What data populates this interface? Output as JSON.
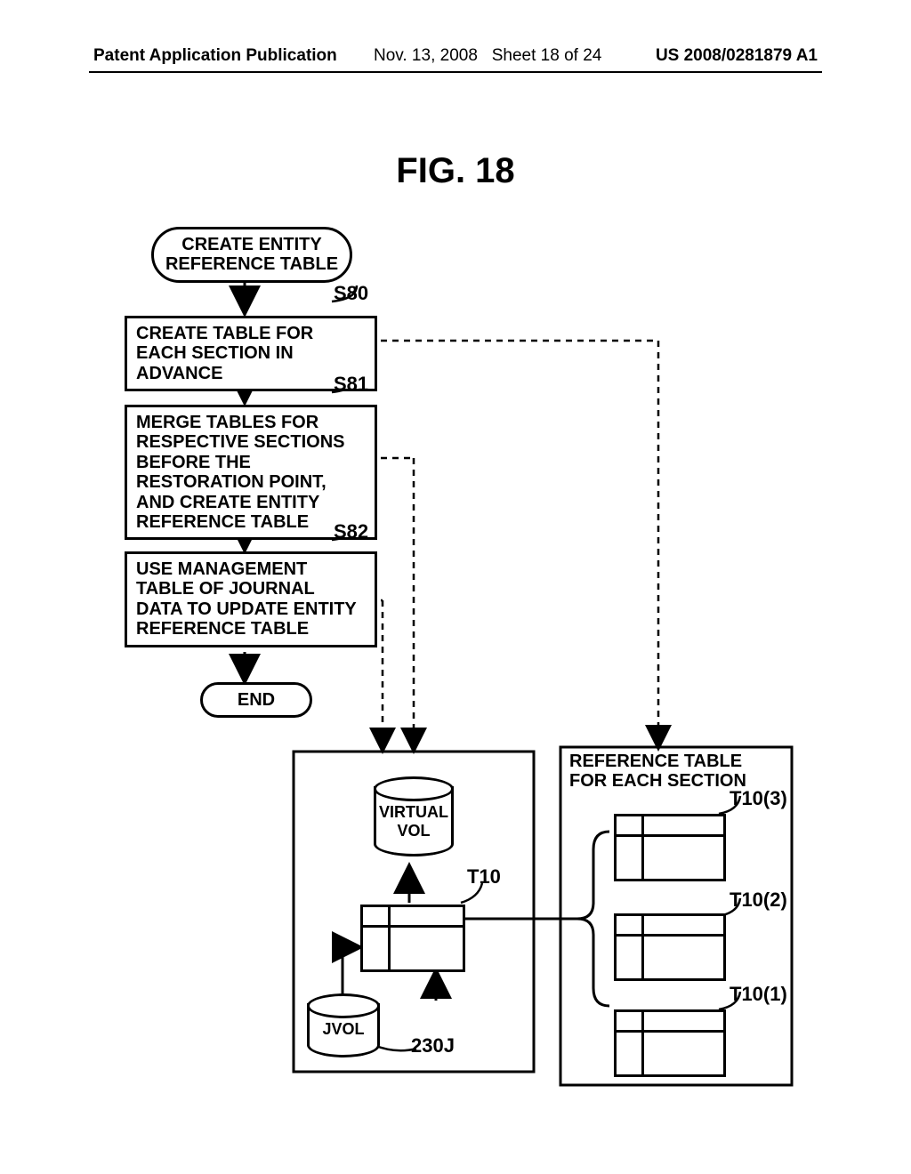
{
  "header": {
    "left": "Patent Application Publication",
    "date": "Nov. 13, 2008",
    "sheet": "Sheet 18 of 24",
    "pubno": "US 2008/0281879 A1"
  },
  "figure_title": "FIG. 18",
  "flowchart": {
    "start": "CREATE ENTITY REFERENCE TABLE",
    "s80": "CREATE TABLE FOR EACH SECTION IN ADVANCE",
    "s80_label": "S80",
    "s81": "MERGE TABLES FOR RESPECTIVE SECTIONS BEFORE THE RESTORATION POINT, AND CREATE ENTITY REFERENCE TABLE",
    "s81_label": "S81",
    "s82": "USE MANAGEMENT TABLE OF JOURNAL DATA TO UPDATE ENTITY REFERENCE TABLE",
    "s82_label": "S82",
    "end": "END"
  },
  "diagram": {
    "virtual_vol": "VIRTUAL VOL",
    "t10": "T10",
    "jvol": "JVOL",
    "jvol_ref": "230J",
    "right_title": "REFERENCE TABLE FOR EACH SECTION",
    "t10_1": "T10(1)",
    "t10_2": "T10(2)",
    "t10_3": "T10(3)"
  }
}
